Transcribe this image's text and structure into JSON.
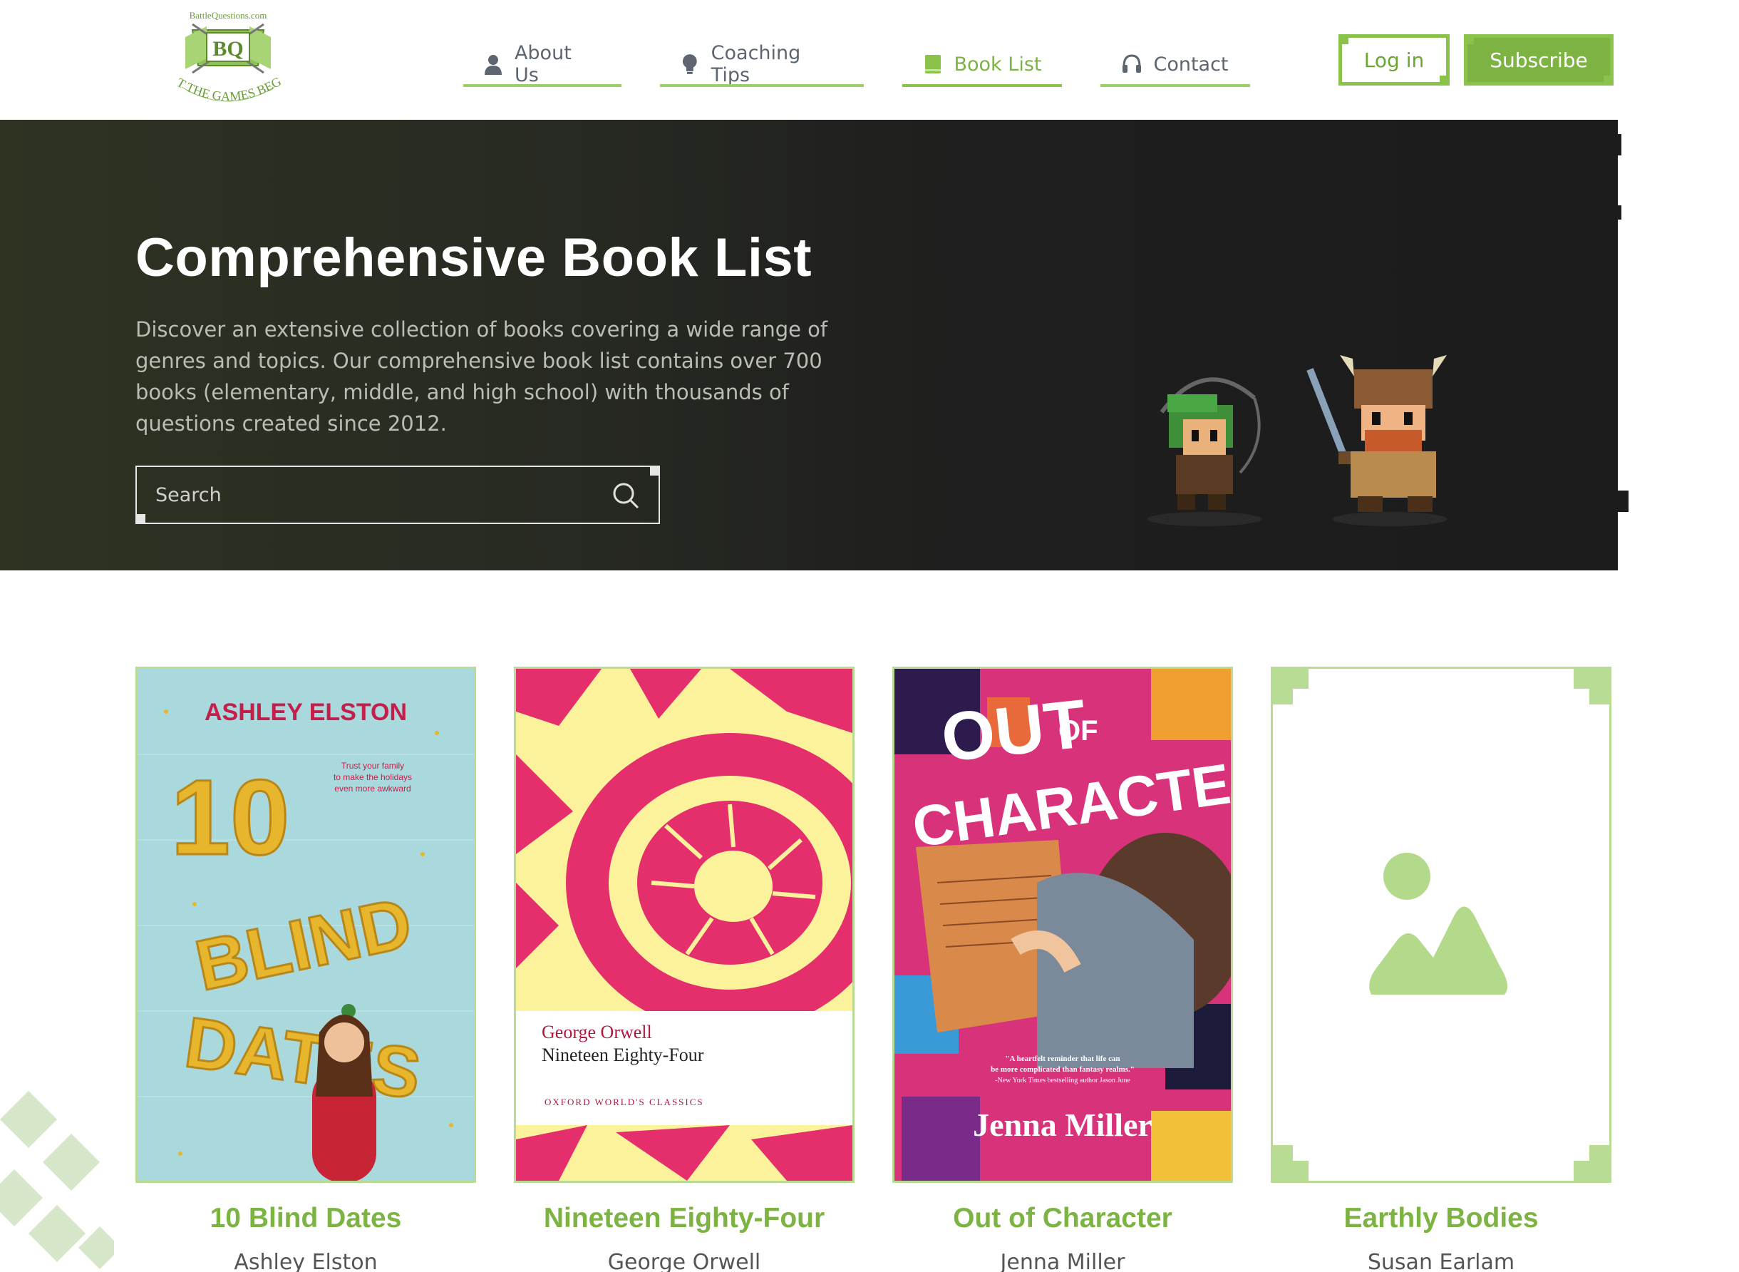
{
  "header": {
    "logo_text_top": "BattleQuestions.com",
    "logo_monogram": "BQ",
    "logo_text_bottom": "LET THE GAMES BEGIN",
    "nav": [
      {
        "label": "About Us",
        "icon": "user-icon",
        "active": false
      },
      {
        "label": "Coaching Tips",
        "icon": "lightbulb-icon",
        "active": false
      },
      {
        "label": "Book List",
        "icon": "book-icon",
        "active": true
      },
      {
        "label": "Contact",
        "icon": "headset-icon",
        "active": false
      }
    ],
    "login_label": "Log in",
    "subscribe_label": "Subscribe"
  },
  "hero": {
    "title": "Comprehensive Book List",
    "description": "Discover an extensive collection of books covering a wide range of genres and topics. Our comprehensive book list contains over 700 books (elementary, middle, and high school) with thousands of questions created since 2012.",
    "search_placeholder": "Search"
  },
  "books": [
    {
      "title": "10 Blind Dates",
      "author": "Ashley Elston",
      "cover": {
        "author_line": "ASHLEY ELSTON",
        "tagline": "Trust your family to make the holidays even more awkward",
        "big": [
          "10",
          "BLIND",
          "DATES"
        ]
      }
    },
    {
      "title": "Nineteen Eighty-Four",
      "author": "George Orwell",
      "cover": {
        "author_line": "George Orwell",
        "title_line": "Nineteen Eighty-Four",
        "series": "OXFORD WORLD'S CLASSICS"
      }
    },
    {
      "title": "Out of Character",
      "author": "Jenna Miller",
      "cover": {
        "title_a": "OUT",
        "title_of": "OF",
        "title_b": "CHARACTER",
        "quote": "\"A heartfelt reminder that life can be more complicated than fantasy realms.\"",
        "quote_source": "-New York Times bestselling author Jason June",
        "author_line": "Jenna Miller"
      }
    },
    {
      "title": "Earthly Bodies",
      "author": "Susan Earlam",
      "cover": {
        "placeholder_icon": "image-placeholder-icon"
      }
    }
  ],
  "colors": {
    "accent": "#7cb342",
    "accent_light": "#b8dc94",
    "hero_bg": "#1e1e1e"
  }
}
